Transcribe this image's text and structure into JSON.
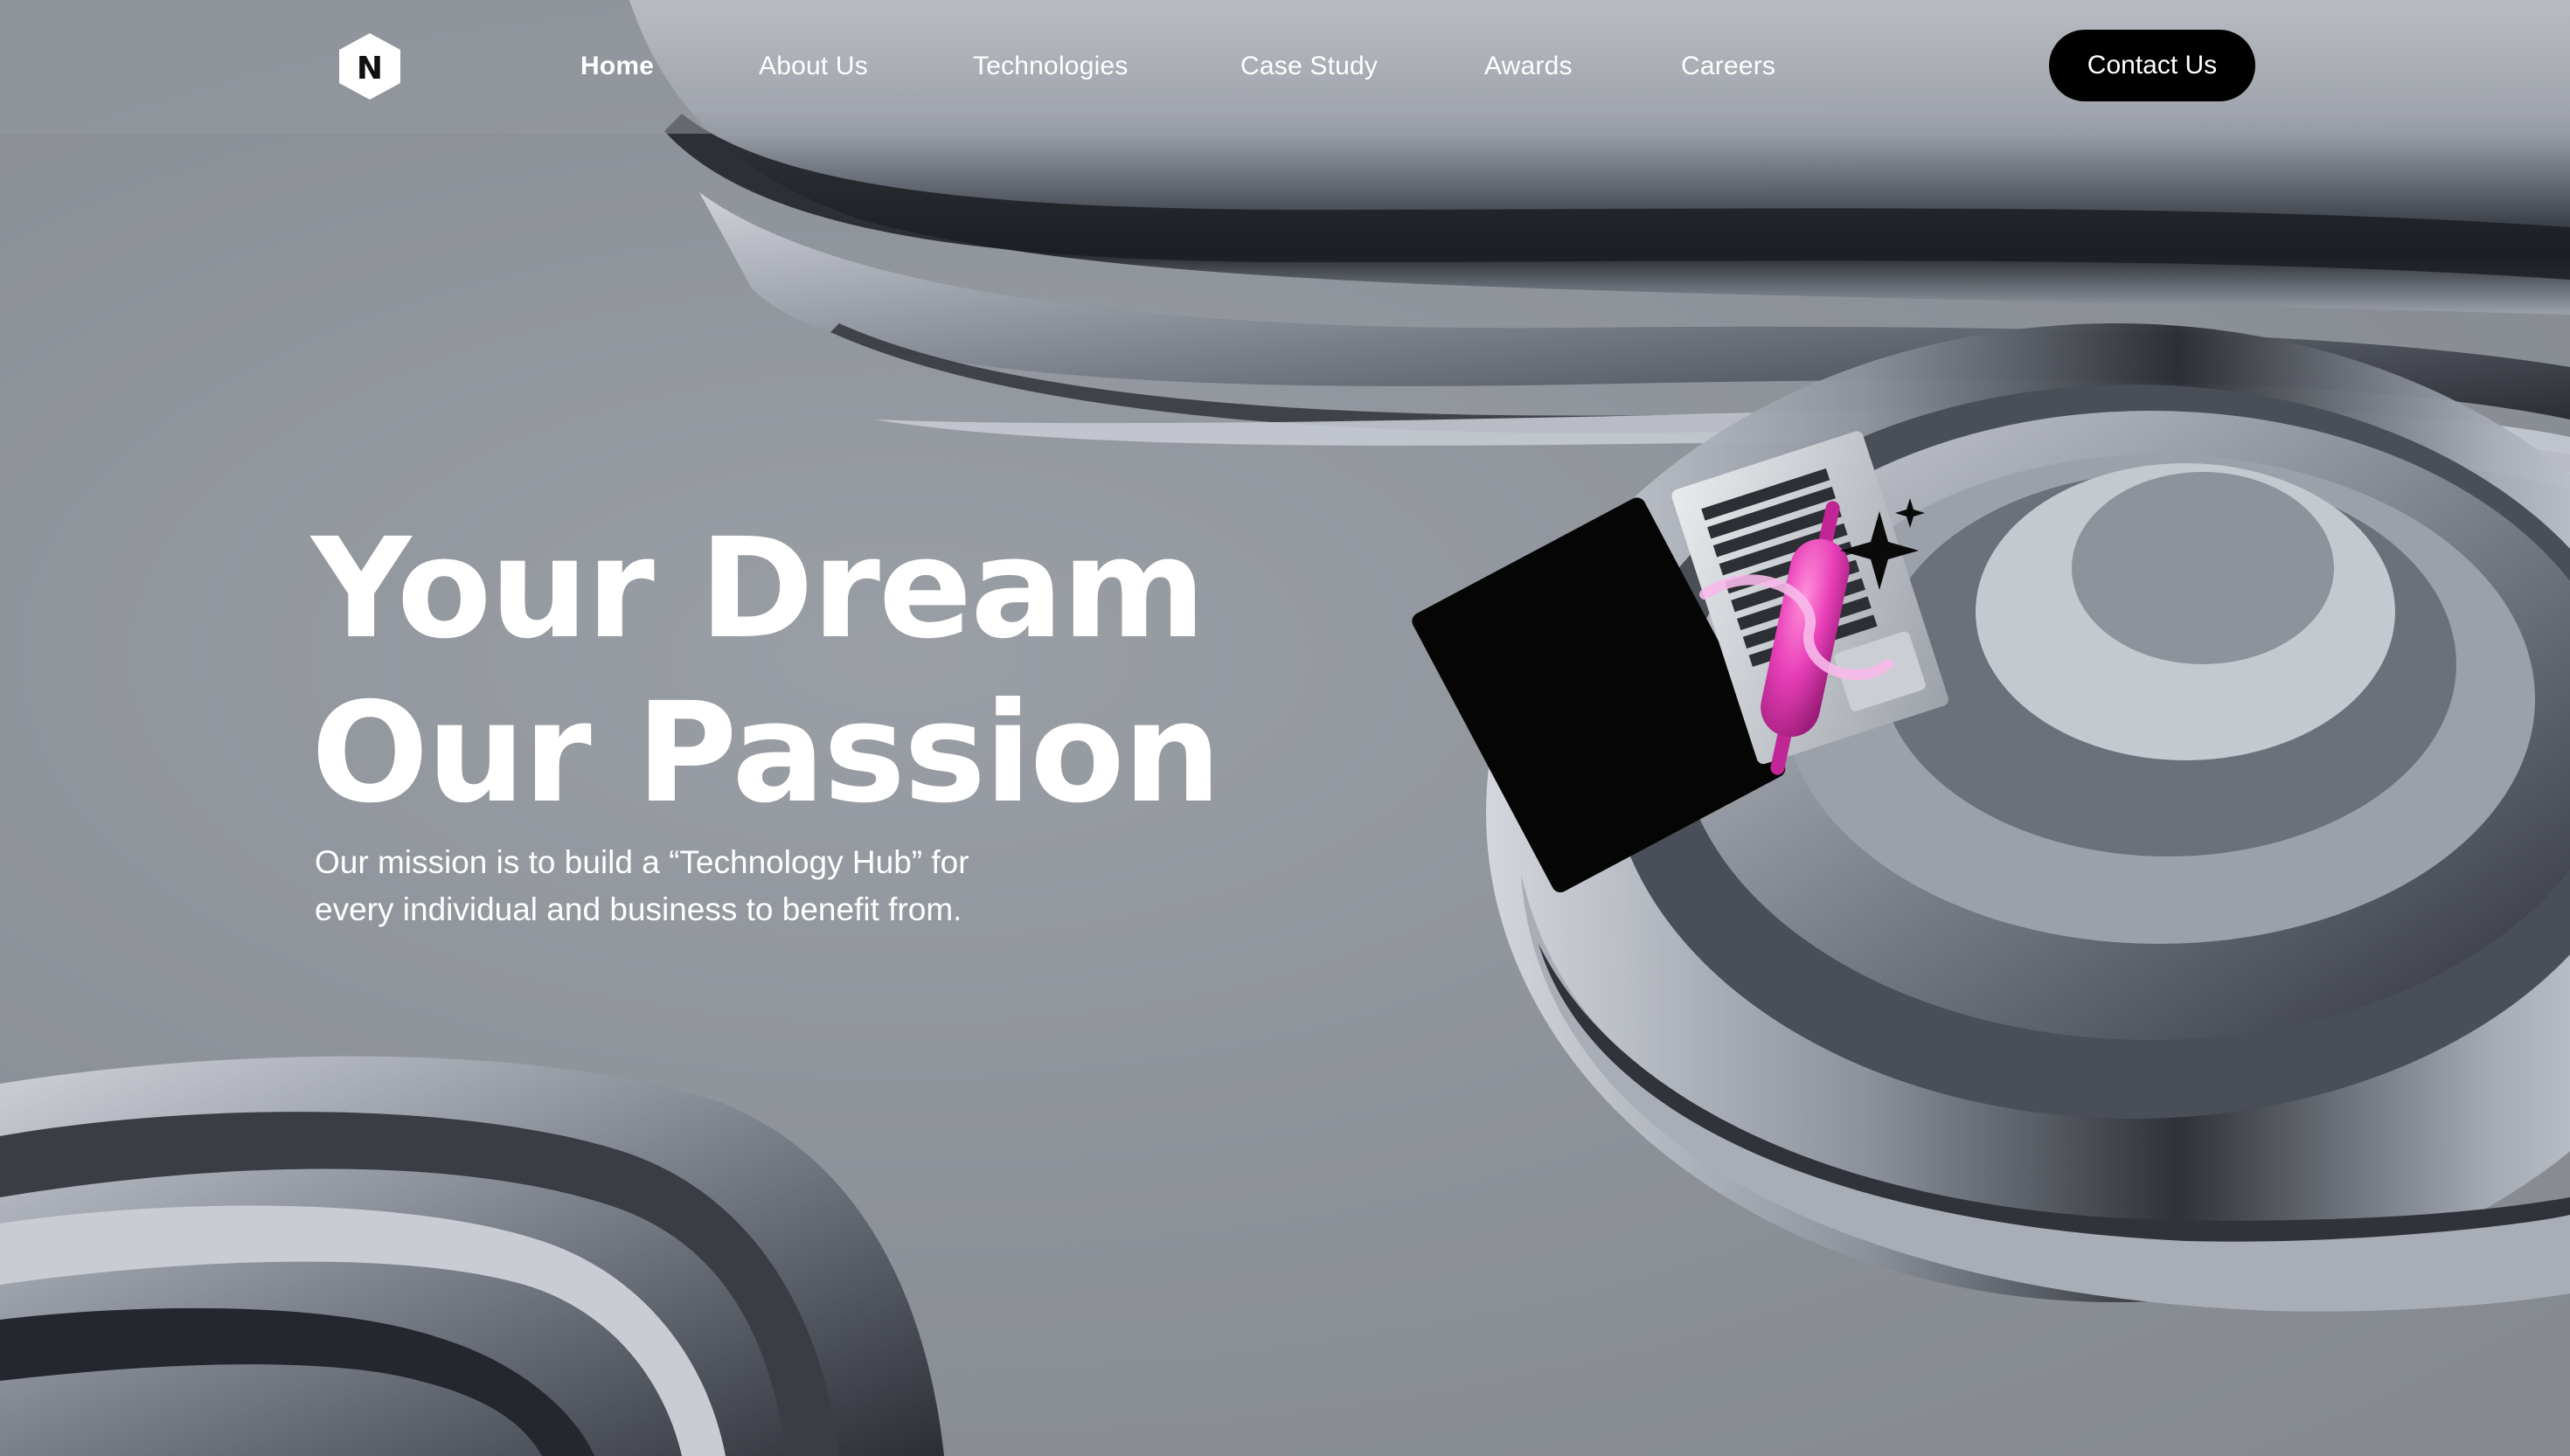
{
  "brand": {
    "logo_icon": "hexagon-n-logo",
    "logo_letter": "N"
  },
  "nav": {
    "items": [
      {
        "label": "Home",
        "active": true
      },
      {
        "label": "About Us",
        "active": false
      },
      {
        "label": "Technologies",
        "active": false
      },
      {
        "label": "Case Study",
        "active": false
      },
      {
        "label": "Awards",
        "active": false
      },
      {
        "label": "Careers",
        "active": false
      }
    ],
    "contact_label": "Contact Us"
  },
  "hero": {
    "headline_line1": "Your Dream",
    "headline_line2": "Our Passion",
    "subtitle_line1": "Our mission is to build a “Technology Hub” for",
    "subtitle_line2": "every individual and business to benefit from.",
    "illustration": "laptop-with-pink-rolling-pin-icon"
  },
  "colors": {
    "background": "#8f939a",
    "text": "#ffffff",
    "button": "#000000",
    "accent_pink": "#e83fb8"
  }
}
